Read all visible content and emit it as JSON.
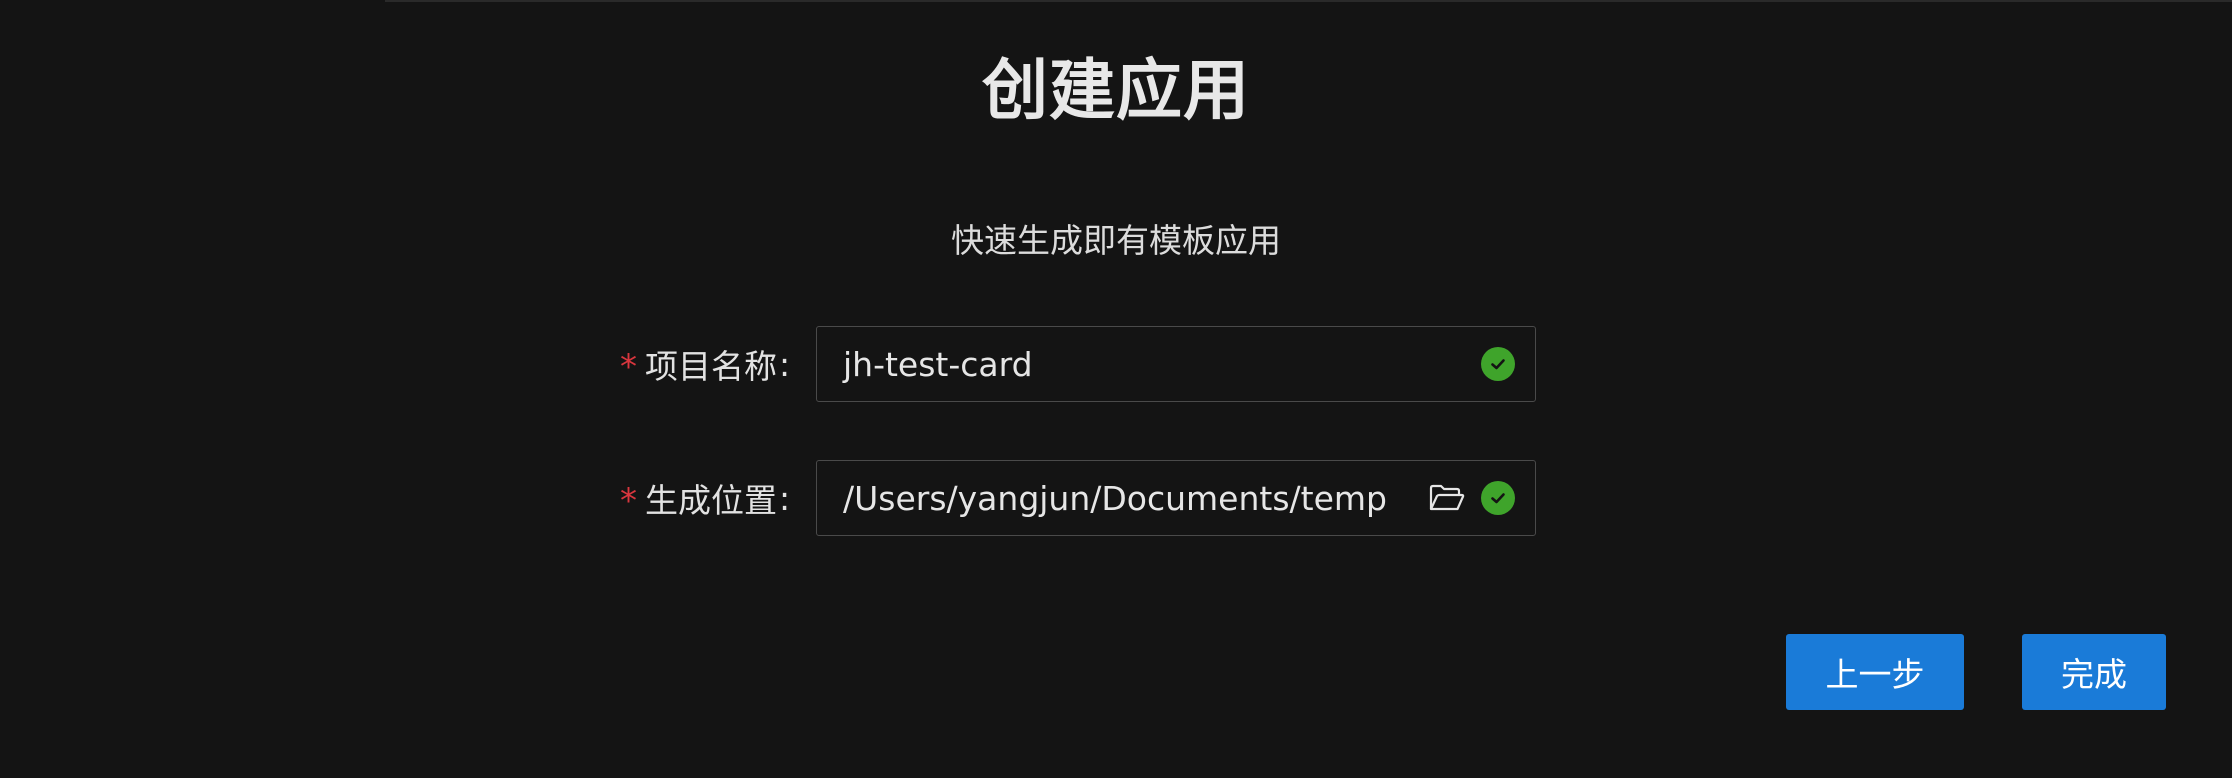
{
  "header": {
    "title": "创建应用",
    "subtitle": "快速生成即有模板应用"
  },
  "form": {
    "project_name": {
      "label": "项目名称",
      "required_mark": "*",
      "colon": ":",
      "value": "jh-test-card",
      "status_icon": "check-circle-icon",
      "status_color": "#3fa42b"
    },
    "location": {
      "label": "生成位置",
      "required_mark": "*",
      "colon": ":",
      "value": "/Users/yangjun/Documents/temp",
      "browse_icon": "folder-open-icon",
      "status_icon": "check-circle-icon",
      "status_color": "#3fa42b"
    }
  },
  "actions": {
    "prev_label": "上一步",
    "done_label": "完成",
    "button_color": "#1a7bd8"
  },
  "colors": {
    "background": "#141414",
    "required": "#d9363e"
  }
}
